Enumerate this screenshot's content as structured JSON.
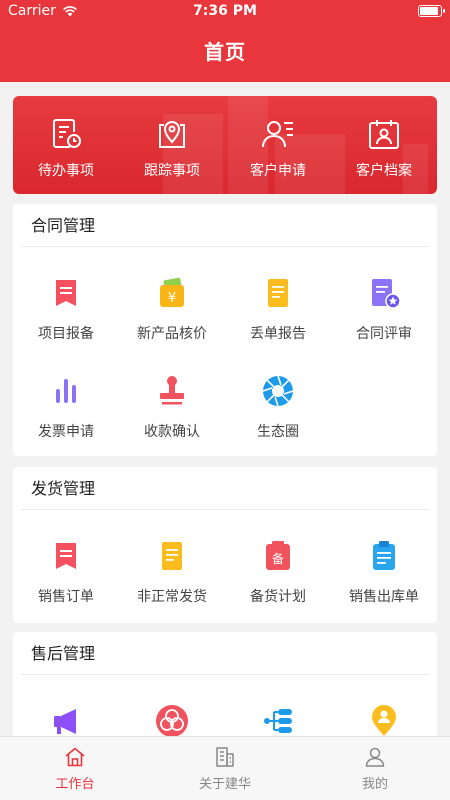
{
  "status_bar": {
    "carrier": "Carrier",
    "time": "7:36 PM"
  },
  "header": {
    "title": "首页"
  },
  "banner": {
    "items": [
      {
        "label": "待办事项",
        "icon": "todo-clock-icon"
      },
      {
        "label": "跟踪事项",
        "icon": "location-track-icon"
      },
      {
        "label": "客户申请",
        "icon": "customer-apply-icon"
      },
      {
        "label": "客户档案",
        "icon": "customer-file-icon"
      }
    ]
  },
  "contract": {
    "title": "合同管理",
    "items": [
      {
        "label": "项目报备",
        "icon": "bookmark-doc-icon"
      },
      {
        "label": "新产品核价",
        "icon": "wallet-yen-icon"
      },
      {
        "label": "丢单报告",
        "icon": "report-doc-icon"
      },
      {
        "label": "合同评审",
        "icon": "contract-star-icon"
      },
      {
        "label": "发票申请",
        "icon": "bar-chart-icon"
      },
      {
        "label": "收款确认",
        "icon": "stamp-icon"
      },
      {
        "label": "生态圈",
        "icon": "aperture-icon"
      }
    ]
  },
  "shipping": {
    "title": "发货管理",
    "items": [
      {
        "label": "销售订单",
        "icon": "order-doc-icon"
      },
      {
        "label": "非正常发货",
        "icon": "abnormal-doc-icon"
      },
      {
        "label": "备货计划",
        "icon": "stock-plan-icon"
      },
      {
        "label": "销售出库单",
        "icon": "clipboard-icon"
      }
    ]
  },
  "after_sales": {
    "title": "售后管理",
    "items": [
      {
        "label": "",
        "icon": "megaphone-icon"
      },
      {
        "label": "",
        "icon": "circles-icon"
      },
      {
        "label": "",
        "icon": "tree-structure-icon"
      },
      {
        "label": "",
        "icon": "person-pin-icon"
      }
    ]
  },
  "tab_bar": {
    "tabs": [
      {
        "label": "工作台",
        "icon": "home-icon",
        "active": true
      },
      {
        "label": "关于建华",
        "icon": "building-icon",
        "active": false
      },
      {
        "label": "我的",
        "icon": "user-icon",
        "active": false
      }
    ]
  },
  "colors": {
    "primary": "#e8363d",
    "tab_active": "#e8363d",
    "tab_inactive": "#888888"
  }
}
